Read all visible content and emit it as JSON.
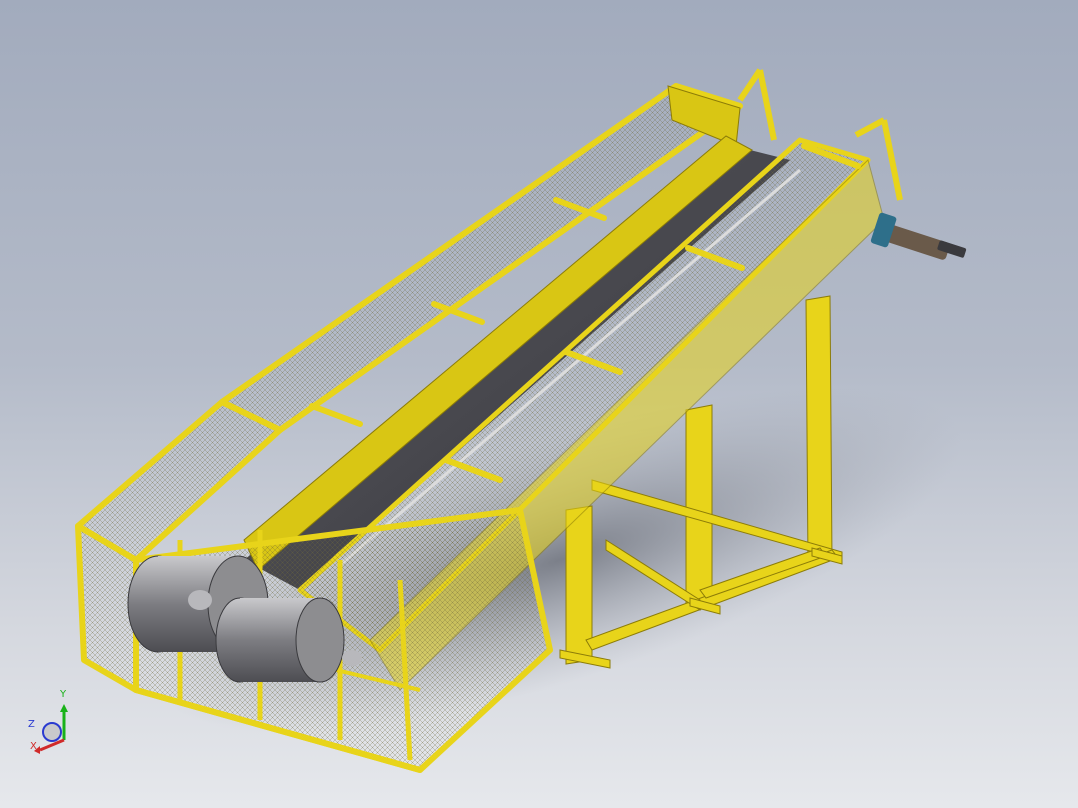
{
  "viewport": {
    "background_top": "#a2abbd",
    "background_bottom": "#e6e8ec"
  },
  "model": {
    "frame_color": "#e8d41a",
    "frame_shadow_color": "#b8a30e",
    "mesh_color": "#6e6a3a",
    "belt_color": "#4a4a4f",
    "roller_color": "#8d8d90",
    "motor_color": "#6a5a4a"
  },
  "triad": {
    "y_label": "Y",
    "z_label": "Z",
    "x_label": "X",
    "y_color": "#19b219",
    "z_color": "#2a3ad0",
    "x_color": "#d02a2a"
  }
}
